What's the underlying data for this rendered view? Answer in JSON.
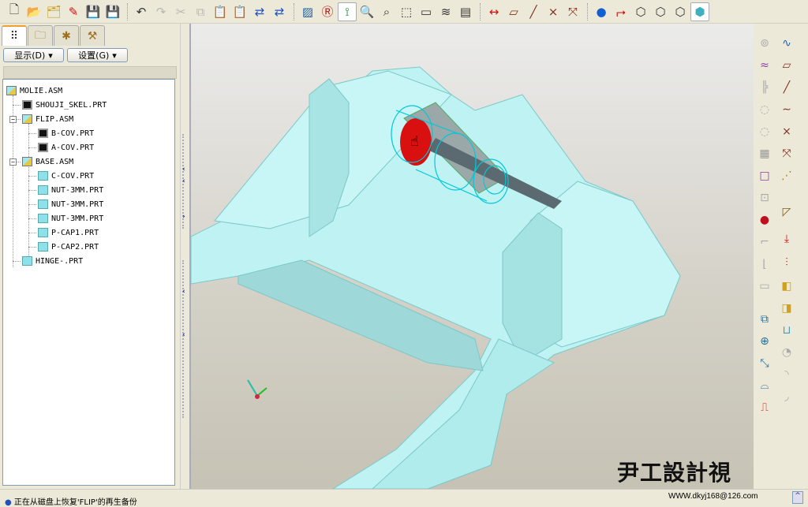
{
  "toolbar": {
    "icons": [
      "new-icon",
      "open-icon",
      "select-working-dir-icon",
      "erase-icon",
      "save-icon",
      "save-as-icon",
      "undo-icon",
      "redo-icon",
      "cut-icon",
      "copy-icon",
      "paste-icon",
      "paste-special-icon",
      "regenerate-icon",
      "regen-manager-icon",
      "sketch-view-icon",
      "repaint-icon",
      "spin-center-icon",
      "zoom-in-icon",
      "refit-icon",
      "orient-icon",
      "saved-views-icon",
      "layers-icon",
      "view-manager-icon",
      "dimension-icon",
      "datum-plane-icon",
      "datum-axis-icon",
      "datum-point-icon",
      "csys-icon",
      "model-tree-icon",
      "redo-red-icon",
      "wireframe-icon",
      "hidden-line-icon",
      "no-hidden-icon",
      "shading-icon"
    ]
  },
  "left_panel": {
    "display_btn": "显示(D)",
    "settings_btn": "设置(G)",
    "tree": [
      {
        "label": "MOLIE.ASM",
        "type": "asm"
      },
      {
        "label": "SHOUJI_SKEL.PRT",
        "type": "skel"
      },
      {
        "label": "FLIP.ASM",
        "type": "asm"
      },
      {
        "label": "B-COV.PRT",
        "type": "skel"
      },
      {
        "label": "A-COV.PRT",
        "type": "skel"
      },
      {
        "label": "BASE.ASM",
        "type": "asm"
      },
      {
        "label": "C-COV.PRT",
        "type": "prt"
      },
      {
        "label": "NUT-3MM.PRT",
        "type": "prt"
      },
      {
        "label": "NUT-3MM.PRT",
        "type": "prt"
      },
      {
        "label": "NUT-3MM.PRT",
        "type": "prt"
      },
      {
        "label": "P-CAP1.PRT",
        "type": "prt"
      },
      {
        "label": "P-CAP2.PRT",
        "type": "prt"
      },
      {
        "label": "HINGE-.PRT",
        "type": "prt"
      }
    ]
  },
  "status": {
    "message": "正在从磁盘上恢复'FLIP'的再生备份",
    "url": "WWW.dkyj168@126.com"
  },
  "watermark": "尹工設計視頻",
  "colors": {
    "model": "#b8f0f0",
    "highlight": "#00c8d8",
    "selected": "#d81010"
  }
}
